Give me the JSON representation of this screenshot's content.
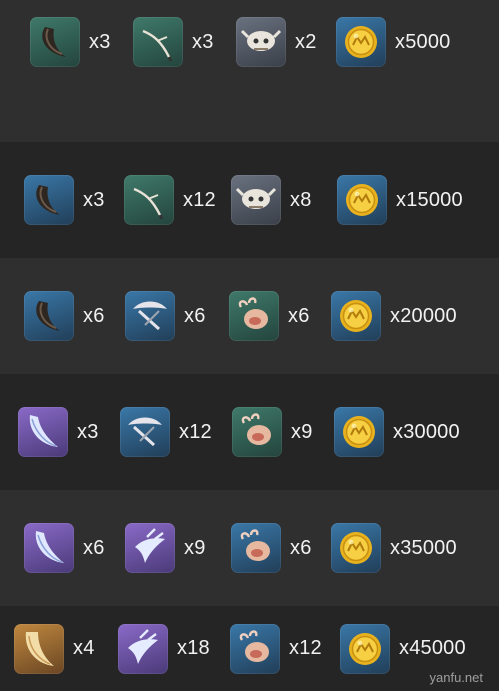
{
  "rows": [
    {
      "items": [
        {
          "icon": "horn-icon",
          "rarity": "green",
          "qty": "x3"
        },
        {
          "icon": "branch-icon",
          "rarity": "green",
          "qty": "x3"
        },
        {
          "icon": "skull-icon",
          "rarity": "gray",
          "qty": "x2"
        },
        {
          "icon": "mora-coin-icon",
          "rarity": "blue",
          "qty": "x5000"
        }
      ]
    },
    {
      "items": [
        {
          "icon": "horn-icon",
          "rarity": "blue",
          "qty": "x3"
        },
        {
          "icon": "branch-icon",
          "rarity": "green",
          "qty": "x12"
        },
        {
          "icon": "skull-icon",
          "rarity": "gray",
          "qty": "x8"
        },
        {
          "icon": "mora-coin-icon",
          "rarity": "blue",
          "qty": "x15000"
        }
      ]
    },
    {
      "items": [
        {
          "icon": "horn-icon",
          "rarity": "blue",
          "qty": "x6"
        },
        {
          "icon": "mask-icon",
          "rarity": "blue",
          "qty": "x6"
        },
        {
          "icon": "crab-icon",
          "rarity": "green",
          "qty": "x6"
        },
        {
          "icon": "mora-coin-icon",
          "rarity": "blue",
          "qty": "x20000"
        }
      ]
    },
    {
      "items": [
        {
          "icon": "feather-icon",
          "rarity": "purple",
          "qty": "x3"
        },
        {
          "icon": "mask-icon",
          "rarity": "blue",
          "qty": "x12"
        },
        {
          "icon": "crab-icon",
          "rarity": "green",
          "qty": "x9"
        },
        {
          "icon": "mora-coin-icon",
          "rarity": "blue",
          "qty": "x30000"
        }
      ]
    },
    {
      "items": [
        {
          "icon": "feather-icon",
          "rarity": "purple",
          "qty": "x6"
        },
        {
          "icon": "claw-icon",
          "rarity": "purple",
          "qty": "x9"
        },
        {
          "icon": "crab-icon",
          "rarity": "blue",
          "qty": "x6"
        },
        {
          "icon": "mora-coin-icon",
          "rarity": "blue",
          "qty": "x35000"
        }
      ]
    },
    {
      "items": [
        {
          "icon": "tusk-icon",
          "rarity": "orange",
          "qty": "x4"
        },
        {
          "icon": "claw-icon",
          "rarity": "purple",
          "qty": "x18"
        },
        {
          "icon": "crab-icon",
          "rarity": "blue",
          "qty": "x12"
        },
        {
          "icon": "mora-coin-icon",
          "rarity": "blue",
          "qty": "x45000"
        }
      ]
    }
  ],
  "rarity_colors": {
    "green": [
      "#3f7a6a",
      "#24443c"
    ],
    "gray": [
      "#6a7280",
      "#3a3f48"
    ],
    "blue": [
      "#3a78a8",
      "#213e58"
    ],
    "purple": [
      "#8a6ac8",
      "#4a3a78"
    ],
    "orange": [
      "#c0883e",
      "#6a4624"
    ]
  },
  "watermark": "yanfu.net"
}
